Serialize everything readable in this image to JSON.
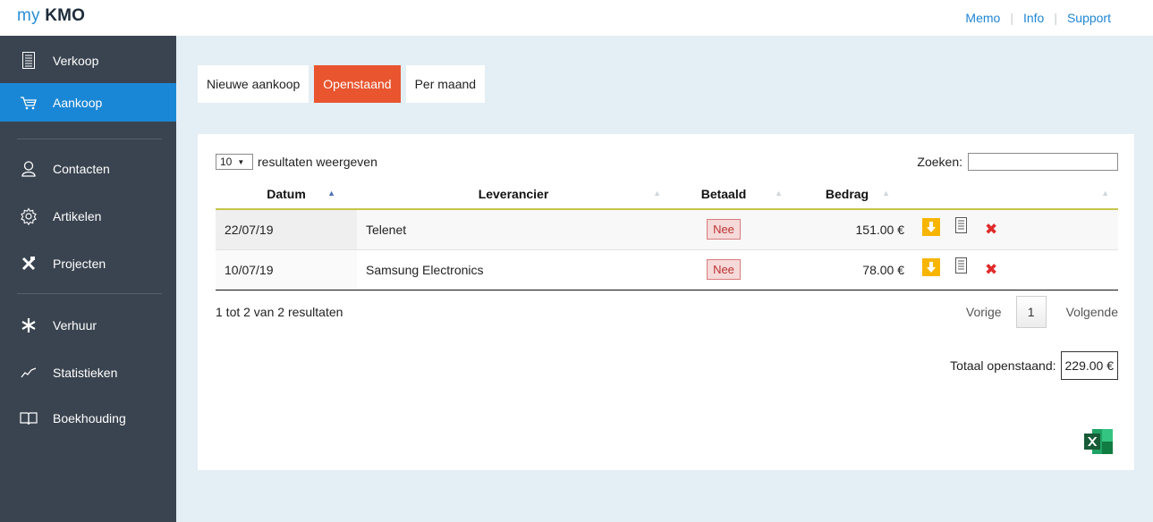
{
  "app": {
    "logo_prefix": "my",
    "logo_main": "KMO"
  },
  "toplinks": {
    "memo": "Memo",
    "info": "Info",
    "support": "Support"
  },
  "sidebar": {
    "items": [
      {
        "label": "Verkoop",
        "icon": "document-icon"
      },
      {
        "label": "Aankoop",
        "icon": "cart-icon",
        "active": true
      },
      {
        "label": "Contacten",
        "icon": "person-icon"
      },
      {
        "label": "Artikelen",
        "icon": "gear-icon"
      },
      {
        "label": "Projecten",
        "icon": "tools-icon"
      },
      {
        "label": "Verhuur",
        "icon": "star-icon"
      },
      {
        "label": "Statistieken",
        "icon": "chart-line-icon"
      },
      {
        "label": "Boekhouding",
        "icon": "book-icon"
      }
    ]
  },
  "tabs": [
    {
      "label": "Nieuwe aankoop"
    },
    {
      "label": "Openstaand",
      "active": true
    },
    {
      "label": "Per maand"
    }
  ],
  "table_controls": {
    "length_value": "10",
    "length_label": "resultaten weergeven",
    "search_label": "Zoeken:",
    "search_value": ""
  },
  "table": {
    "columns": [
      "Datum",
      "Leverancier",
      "Betaald",
      "Bedrag",
      ""
    ],
    "rows": [
      {
        "datum": "22/07/19",
        "leverancier": "Telenet",
        "betaald": "Nee",
        "bedrag": "151.00 €"
      },
      {
        "datum": "10/07/19",
        "leverancier": "Samsung Electronics",
        "betaald": "Nee",
        "bedrag": "78.00 €"
      }
    ]
  },
  "footer": {
    "info": "1 tot 2 van 2 resultaten",
    "prev": "Vorige",
    "page": "1",
    "next": "Volgende",
    "total_label": "Totaal openstaand:",
    "total_value": "229.00 €"
  },
  "colors": {
    "accent": "#1a87d6",
    "active_tab": "#e8552f",
    "sidebar": "#3a4450",
    "download": "#f7b500",
    "delete": "#e02b2b"
  }
}
